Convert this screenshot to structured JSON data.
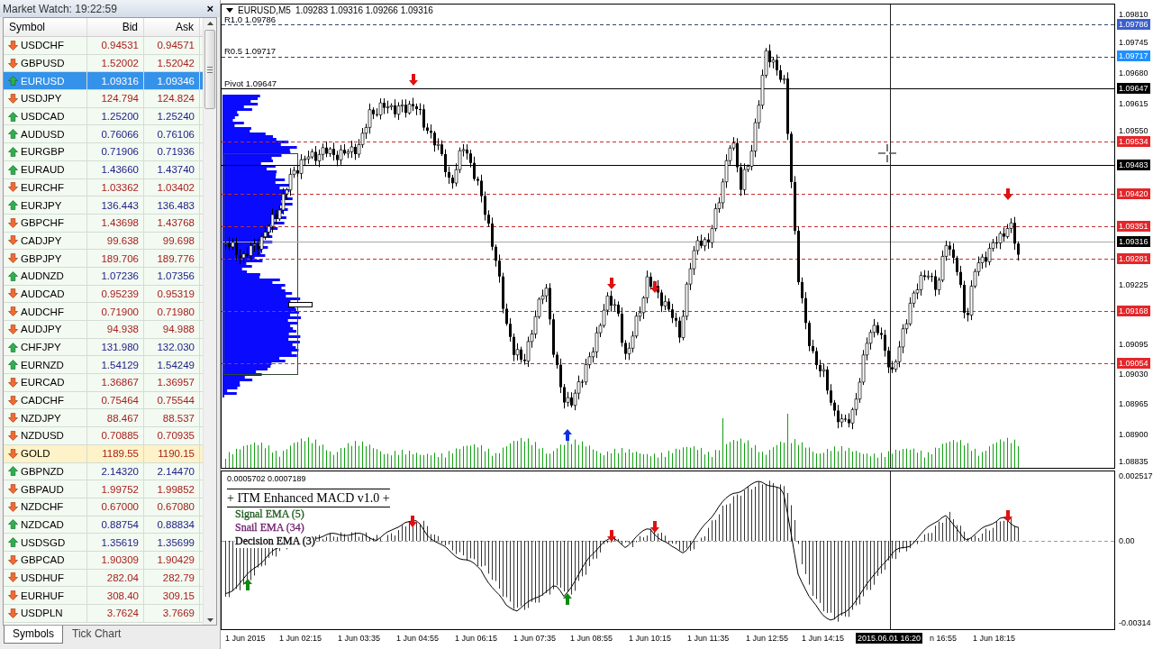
{
  "market_watch": {
    "title": "Market Watch: 19:22:59",
    "close": "×",
    "columns": [
      "Symbol",
      "Bid",
      "Ask"
    ],
    "rows": [
      {
        "symbol": "USDCHF",
        "rising": false,
        "bid": "0.94531",
        "ask": "0.94571",
        "selected": false,
        "highlighted": false
      },
      {
        "symbol": "GBPUSD",
        "rising": false,
        "bid": "1.52002",
        "ask": "1.52042",
        "selected": false,
        "highlighted": false
      },
      {
        "symbol": "EURUSD",
        "rising": true,
        "bid": "1.09316",
        "ask": "1.09346",
        "selected": true,
        "highlighted": false
      },
      {
        "symbol": "USDJPY",
        "rising": false,
        "bid": "124.794",
        "ask": "124.824",
        "selected": false,
        "highlighted": false
      },
      {
        "symbol": "USDCAD",
        "rising": true,
        "bid": "1.25200",
        "ask": "1.25240",
        "selected": false,
        "highlighted": false
      },
      {
        "symbol": "AUDUSD",
        "rising": true,
        "bid": "0.76066",
        "ask": "0.76106",
        "selected": false,
        "highlighted": false
      },
      {
        "symbol": "EURGBP",
        "rising": true,
        "bid": "0.71906",
        "ask": "0.71936",
        "selected": false,
        "highlighted": false
      },
      {
        "symbol": "EURAUD",
        "rising": true,
        "bid": "1.43660",
        "ask": "1.43740",
        "selected": false,
        "highlighted": false
      },
      {
        "symbol": "EURCHF",
        "rising": false,
        "bid": "1.03362",
        "ask": "1.03402",
        "selected": false,
        "highlighted": false
      },
      {
        "symbol": "EURJPY",
        "rising": true,
        "bid": "136.443",
        "ask": "136.483",
        "selected": false,
        "highlighted": false
      },
      {
        "symbol": "GBPCHF",
        "rising": false,
        "bid": "1.43698",
        "ask": "1.43768",
        "selected": false,
        "highlighted": false
      },
      {
        "symbol": "CADJPY",
        "rising": false,
        "bid": "99.638",
        "ask": "99.698",
        "selected": false,
        "highlighted": false
      },
      {
        "symbol": "GBPJPY",
        "rising": false,
        "bid": "189.706",
        "ask": "189.776",
        "selected": false,
        "highlighted": false
      },
      {
        "symbol": "AUDNZD",
        "rising": true,
        "bid": "1.07236",
        "ask": "1.07356",
        "selected": false,
        "highlighted": false
      },
      {
        "symbol": "AUDCAD",
        "rising": false,
        "bid": "0.95239",
        "ask": "0.95319",
        "selected": false,
        "highlighted": false
      },
      {
        "symbol": "AUDCHF",
        "rising": false,
        "bid": "0.71900",
        "ask": "0.71980",
        "selected": false,
        "highlighted": false
      },
      {
        "symbol": "AUDJPY",
        "rising": false,
        "bid": "94.938",
        "ask": "94.988",
        "selected": false,
        "highlighted": false
      },
      {
        "symbol": "CHFJPY",
        "rising": true,
        "bid": "131.980",
        "ask": "132.030",
        "selected": false,
        "highlighted": false
      },
      {
        "symbol": "EURNZD",
        "rising": true,
        "bid": "1.54129",
        "ask": "1.54249",
        "selected": false,
        "highlighted": false
      },
      {
        "symbol": "EURCAD",
        "rising": false,
        "bid": "1.36867",
        "ask": "1.36957",
        "selected": false,
        "highlighted": false
      },
      {
        "symbol": "CADCHF",
        "rising": false,
        "bid": "0.75464",
        "ask": "0.75544",
        "selected": false,
        "highlighted": false
      },
      {
        "symbol": "NZDJPY",
        "rising": false,
        "bid": "88.467",
        "ask": "88.537",
        "selected": false,
        "highlighted": false
      },
      {
        "symbol": "NZDUSD",
        "rising": false,
        "bid": "0.70885",
        "ask": "0.70935",
        "selected": false,
        "highlighted": false
      },
      {
        "symbol": "GOLD",
        "rising": false,
        "bid": "1189.55",
        "ask": "1190.15",
        "selected": false,
        "highlighted": true
      },
      {
        "symbol": "GBPNZD",
        "rising": true,
        "bid": "2.14320",
        "ask": "2.14470",
        "selected": false,
        "highlighted": false
      },
      {
        "symbol": "GBPAUD",
        "rising": false,
        "bid": "1.99752",
        "ask": "1.99852",
        "selected": false,
        "highlighted": false
      },
      {
        "symbol": "NZDCHF",
        "rising": false,
        "bid": "0.67000",
        "ask": "0.67080",
        "selected": false,
        "highlighted": false
      },
      {
        "symbol": "NZDCAD",
        "rising": true,
        "bid": "0.88754",
        "ask": "0.88834",
        "selected": false,
        "highlighted": false
      },
      {
        "symbol": "USDSGD",
        "rising": true,
        "bid": "1.35619",
        "ask": "1.35699",
        "selected": false,
        "highlighted": false
      },
      {
        "symbol": "GBPCAD",
        "rising": false,
        "bid": "1.90309",
        "ask": "1.90429",
        "selected": false,
        "highlighted": false
      },
      {
        "symbol": "USDHUF",
        "rising": false,
        "bid": "282.04",
        "ask": "282.79",
        "selected": false,
        "highlighted": false
      },
      {
        "symbol": "EURHUF",
        "rising": false,
        "bid": "308.40",
        "ask": "309.15",
        "selected": false,
        "highlighted": false
      },
      {
        "symbol": "USDPLN",
        "rising": false,
        "bid": "3.7624",
        "ask": "3.7669",
        "selected": false,
        "highlighted": false
      }
    ],
    "tabs": [
      {
        "label": "Symbols",
        "selected": true
      },
      {
        "label": "Tick Chart",
        "selected": false
      }
    ]
  },
  "chart": {
    "symbol": "EURUSD,M5",
    "ohlc": "1.09283 1.09316 1.09266 1.09316",
    "level_labels": [
      "R1.0 1.09786",
      "R0.5 1.09717",
      "Pivot 1.09647"
    ],
    "price_axis": [
      {
        "label": "1.09810",
        "kind": "tick"
      },
      {
        "label": "1.09786",
        "kind": "level",
        "color": "#3a5fcd"
      },
      {
        "label": "1.09745",
        "kind": "tick"
      },
      {
        "label": "1.09717",
        "kind": "level",
        "color": "#1e90ff"
      },
      {
        "label": "1.09680",
        "kind": "tick"
      },
      {
        "label": "1.09647",
        "kind": "level",
        "color": "#000000"
      },
      {
        "label": "1.09615",
        "kind": "tick"
      },
      {
        "label": "1.09550",
        "kind": "tick"
      },
      {
        "label": "1.09534",
        "kind": "level",
        "color": "#e3262a"
      },
      {
        "label": "1.09483",
        "kind": "level",
        "color": "#000000"
      },
      {
        "label": "1.09420",
        "kind": "level",
        "color": "#e3262a"
      },
      {
        "label": "1.09351",
        "kind": "level",
        "color": "#e3262a"
      },
      {
        "label": "1.09316",
        "kind": "level",
        "color": "#000000"
      },
      {
        "label": "1.09281",
        "kind": "level",
        "color": "#e3262a"
      },
      {
        "label": "1.09225",
        "kind": "tick"
      },
      {
        "label": "1.09168",
        "kind": "level",
        "color": "#e3262a"
      },
      {
        "label": "1.09095",
        "kind": "tick"
      },
      {
        "label": "1.09054",
        "kind": "level",
        "color": "#e3262a"
      },
      {
        "label": "1.09030",
        "kind": "tick"
      },
      {
        "label": "1.08965",
        "kind": "tick"
      },
      {
        "label": "1.08900",
        "kind": "tick"
      },
      {
        "label": "1.08835",
        "kind": "tick"
      }
    ]
  },
  "indicator": {
    "values": "0.0005702 0.0007189",
    "title": "+ ITM Enhanced MACD v1.0 +",
    "legend": [
      {
        "label": "Signal EMA (5)",
        "color": "#1e5a1e"
      },
      {
        "label": "Snail EMA (34)",
        "color": "#6a1b6a"
      },
      {
        "label": "Decision EMA (3)",
        "color": "#000000"
      }
    ],
    "axis": [
      "0.002517",
      "0.00",
      "-0.00314"
    ]
  },
  "time_axis": [
    {
      "label": "1 Jun 2015",
      "kind": "tick"
    },
    {
      "label": "1 Jun 02:15",
      "kind": "tick"
    },
    {
      "label": "1 Jun 03:35",
      "kind": "tick"
    },
    {
      "label": "1 Jun 04:55",
      "kind": "tick"
    },
    {
      "label": "1 Jun 06:15",
      "kind": "tick"
    },
    {
      "label": "1 Jun 07:35",
      "kind": "tick"
    },
    {
      "label": "1 Jun 08:55",
      "kind": "tick"
    },
    {
      "label": "1 Jun 10:15",
      "kind": "tick"
    },
    {
      "label": "1 Jun 11:35",
      "kind": "tick"
    },
    {
      "label": "1 Jun 12:55",
      "kind": "tick"
    },
    {
      "label": "1 Jun 14:15",
      "kind": "tick"
    },
    {
      "label": "2015.06.01 16:20",
      "kind": "cursor"
    },
    {
      "label": "n 16:55",
      "kind": "tick"
    },
    {
      "label": "1 Jun 18:15",
      "kind": "tick"
    }
  ]
}
